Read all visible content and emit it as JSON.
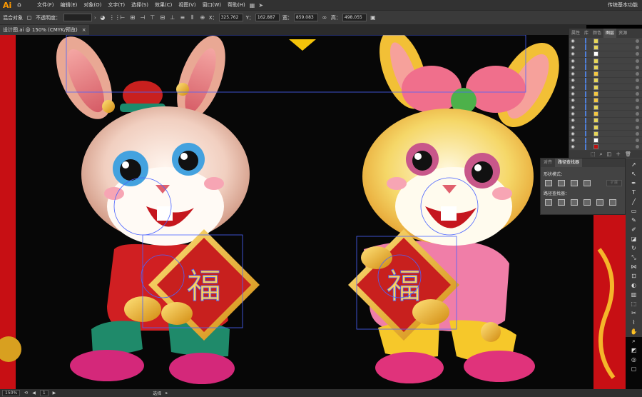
{
  "app": {
    "logo": "Ai",
    "workspace": "传统基本功能"
  },
  "menu": [
    "文件(F)",
    "编辑(E)",
    "对象(O)",
    "文字(T)",
    "选择(S)",
    "效果(C)",
    "视图(V)",
    "窗口(W)",
    "帮助(H)"
  ],
  "control": {
    "mixed_label": "混合对象",
    "opacity_label": "不透明度：",
    "x_label": "X：",
    "x_value": "325.762",
    "y_label": "Y：",
    "y_value": "162.887",
    "w_label": "宽：",
    "w_value": "859.083",
    "h_label": "高：",
    "h_value": "498.055"
  },
  "tab": {
    "title": "设计图.ai @ 150% (CMYK/预览)",
    "close": "×"
  },
  "layers_panel": {
    "tabs": [
      "属性",
      "库",
      "颜色",
      "图层",
      "资源"
    ],
    "active": "图层",
    "swatches": [
      "#e8d75a",
      "#e8d75a",
      "#ffffff",
      "#e8d75a",
      "#e8d75a",
      "#f5c842",
      "#e8d75a",
      "#e8d75a",
      "#f5c842",
      "#f5c842",
      "#e8d75a",
      "#f5c842",
      "#e8d75a",
      "#e8d75a",
      "#e8d75a",
      "#ffffff",
      "#c01010"
    ]
  },
  "pathfinder": {
    "tabs": [
      "对齐",
      "路径查找器"
    ],
    "active": "路径查找器",
    "shape_modes": "形状模式：",
    "pathfinders": "路径查找器：",
    "expand": "扩展"
  },
  "status": {
    "zoom": "150%",
    "page": "1",
    "tool": "选择"
  },
  "colors": {
    "accent": "#ff9a00",
    "selection": "#4a63ff"
  }
}
